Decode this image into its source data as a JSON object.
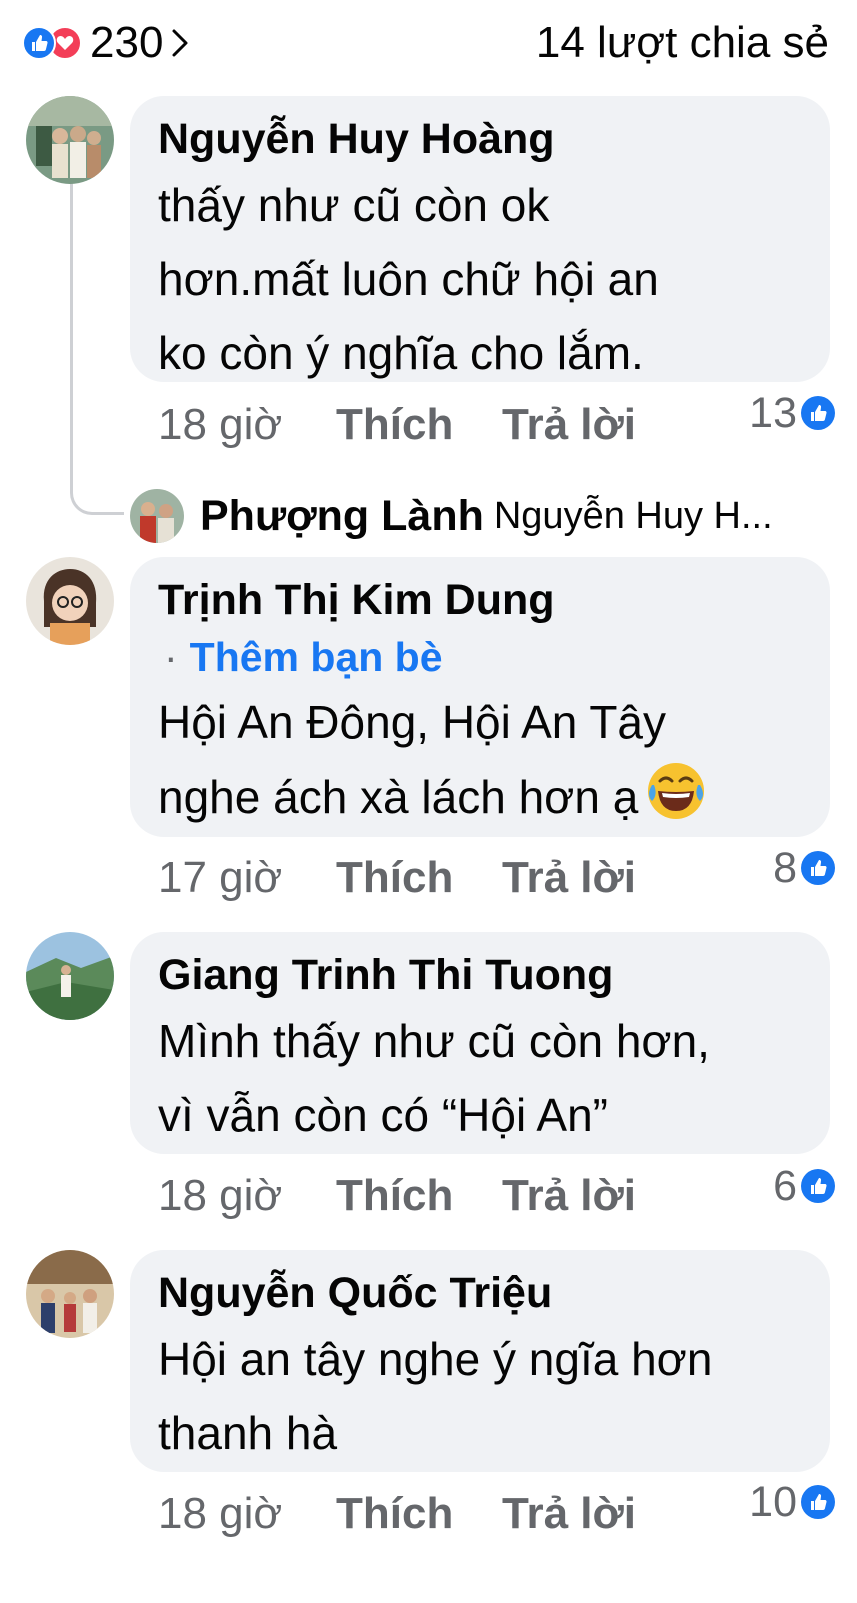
{
  "header": {
    "reaction_count": "230",
    "shares_text": "14 lượt chia sẻ"
  },
  "comments": [
    {
      "author": "Nguyễn Huy Hoàng",
      "lines": [
        "thấy như cũ còn ok",
        "hơn.mất luôn chữ hội an",
        "ko còn ý nghĩa cho lắm."
      ],
      "time": "18 giờ",
      "like_label": "Thích",
      "reply_label": "Trả lời",
      "like_count": "13"
    },
    {
      "author": "Trịnh Thị Kim Dung",
      "add_friend": "Thêm bạn bè",
      "lines": [
        "Hội An Đông, Hội An Tây",
        "nghe ách xà lách hơn ạ"
      ],
      "time": "17 giờ",
      "like_label": "Thích",
      "reply_label": "Trả lời",
      "like_count": "8"
    },
    {
      "author": "Giang Trinh Thi Tuong",
      "lines": [
        "Mình thấy như cũ còn hơn,",
        "vì vẫn còn có “Hội An”"
      ],
      "time": "18 giờ",
      "like_label": "Thích",
      "reply_label": "Trả lời",
      "like_count": "6"
    },
    {
      "author": "Nguyễn Quốc Triệu",
      "lines": [
        "Hội an tây nghe ý ngĩa hơn",
        "thanh hà"
      ],
      "time": "18 giờ",
      "like_label": "Thích",
      "reply_label": "Trả lời",
      "like_count": "10"
    }
  ],
  "reply_preview": {
    "author": "Phượng Lành",
    "preview": "Nguyễn Huy H..."
  },
  "colors": {
    "accent": "#1877f2",
    "love": "#f33e58",
    "bubble": "#f0f2f5",
    "meta": "#65676b"
  },
  "icons": [
    "like-reaction-icon",
    "love-reaction-icon",
    "chevron-right-icon",
    "like-badge-icon",
    "laughing-emoji-icon"
  ]
}
